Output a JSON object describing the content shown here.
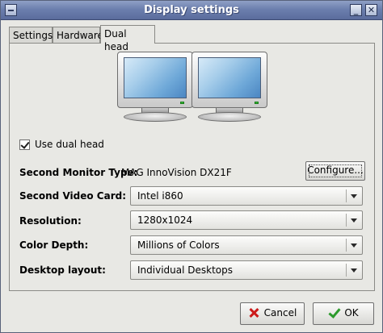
{
  "window": {
    "title": "Display settings"
  },
  "tabs": [
    {
      "label": "Settings",
      "active": false
    },
    {
      "label": "Hardware",
      "active": false
    },
    {
      "label": "Dual head",
      "active": true
    }
  ],
  "dual_head": {
    "use_dual_head": {
      "label": "Use dual head",
      "checked": true
    },
    "second_monitor_type": {
      "label": "Second Monitor Type:",
      "value": "MAG InnoVision DX21F",
      "configure_label": "Configure..."
    },
    "second_video_card": {
      "label": "Second Video Card:",
      "value": "Intel i860"
    },
    "resolution": {
      "label": "Resolution:",
      "value": "1280x1024"
    },
    "color_depth": {
      "label": "Color Depth:",
      "value": "Millions of Colors"
    },
    "desktop_layout": {
      "label": "Desktop layout:",
      "value": "Individual Desktops"
    }
  },
  "buttons": {
    "cancel": "Cancel",
    "ok": "OK"
  },
  "icons": {
    "window_menu": "window-menu-icon",
    "minimize": "minimize-icon",
    "close": "close-icon",
    "monitor": "monitor-icon",
    "cancel": "x-icon",
    "ok": "checkmark-icon"
  }
}
